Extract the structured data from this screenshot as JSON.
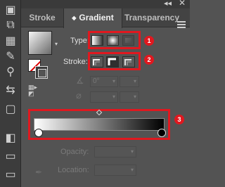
{
  "window": {
    "collapse_glyph": "◂◂",
    "close_glyph": "✕"
  },
  "tabs": [
    {
      "label": "Stroke"
    },
    {
      "label": "Gradient",
      "arrow": "◆"
    },
    {
      "label": "Transparency"
    }
  ],
  "type_row": {
    "label": "Type:",
    "options": [
      "linear-gradient",
      "radial-gradient",
      "freeform-gradient"
    ]
  },
  "stroke_row": {
    "label": "Stroke:",
    "options": [
      "apply-within-stroke",
      "apply-along-stroke",
      "apply-across-stroke"
    ]
  },
  "angle": {
    "value": "0°"
  },
  "aspect": {
    "value": ""
  },
  "slider": {
    "start_color": "#ffffff",
    "end_color": "#000000"
  },
  "opacity": {
    "label": "Opacity:"
  },
  "location": {
    "label": "Location:"
  },
  "callouts": [
    "1",
    "2",
    "3"
  ],
  "callout_color": "#e0181f",
  "dropdown_arrow": "▾"
}
